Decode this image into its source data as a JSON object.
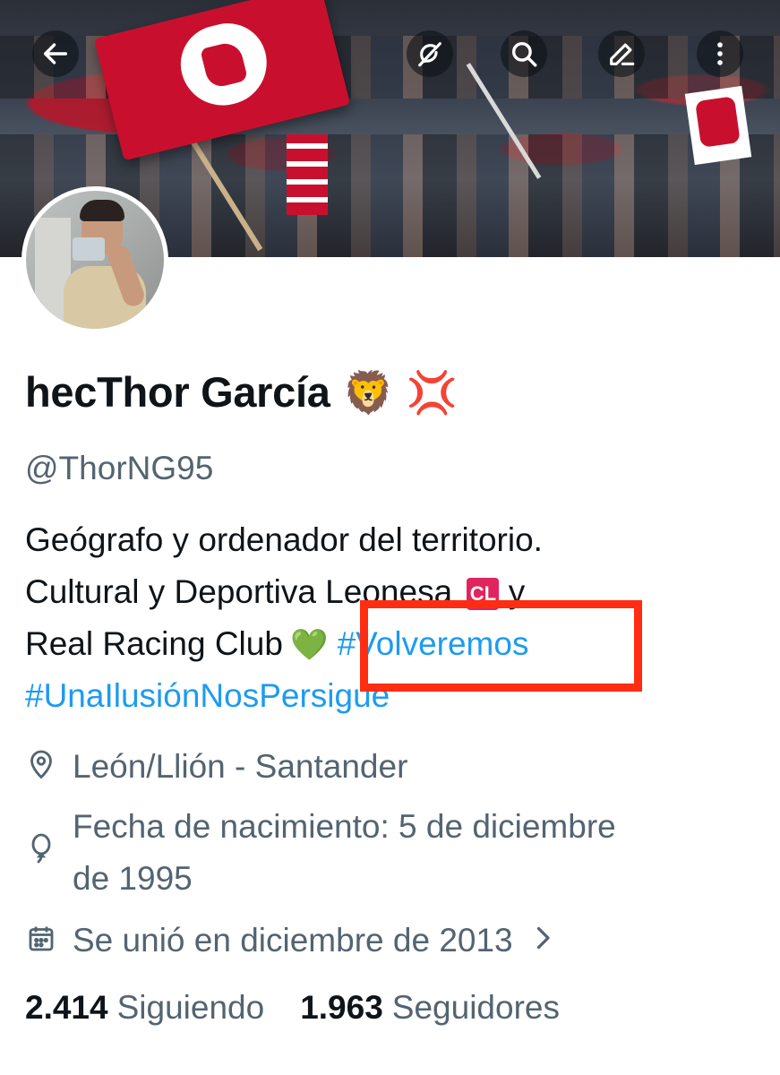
{
  "profile": {
    "display_name": "hecThor García",
    "emoji_1": "🦁",
    "emoji_2": "💢",
    "handle": "@ThorNG95",
    "bio": {
      "line1": "Geógrafo y ordenador del territorio.",
      "line2_text": "Cultural y Deportiva Leonesa",
      "line2_badge": "CL",
      "line2_suffix": "y",
      "line3_text": "Real Racing Club",
      "line3_heart": "💚",
      "hashtag_1": "#Volveremos",
      "hashtag_2": "#UnaIlusiónNosPersigue"
    },
    "location": "León/Llión - Santander",
    "birthdate_line1": "Fecha de nacimiento: 5 de diciembre",
    "birthdate_line2": "de 1995",
    "joined": "Se unió en diciembre de 2013",
    "following_count": "2.414",
    "following_label": "Siguiendo",
    "followers_count": "1.963",
    "followers_label": "Seguidores"
  },
  "colors": {
    "hashtag": "#1d9bf0",
    "secondary_text": "#536471",
    "primary_text": "#0f1419",
    "highlight": "#ff2d12"
  },
  "icons": {
    "back": "arrow-left-icon",
    "grok": "grok-icon",
    "search": "search-icon",
    "edit": "pencil-icon",
    "more": "more-vertical-icon",
    "location": "map-pin-icon",
    "birthday": "balloon-icon",
    "joined": "calendar-icon",
    "chevron": "chevron-right-icon"
  }
}
